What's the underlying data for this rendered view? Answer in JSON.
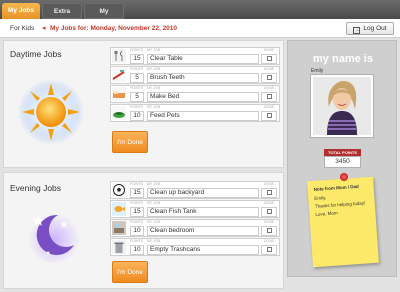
{
  "nav": {
    "tabs": [
      {
        "label": "My Jobs",
        "active": true
      },
      {
        "label": "Extra Jobs",
        "active": false
      },
      {
        "label": "My Store",
        "active": false
      }
    ]
  },
  "subbar": {
    "section": "For Kids",
    "heading": "My Jobs for: Monday, November 22, 2010",
    "logout": "Log Out"
  },
  "columns": {
    "points": "POINTS",
    "job": "MY JOB",
    "done": "DONE"
  },
  "daytime": {
    "title": "Daytime Jobs",
    "done_button": "I'm Done",
    "jobs": [
      {
        "points": "15",
        "name": "Clear Table",
        "icon": "utensils-icon"
      },
      {
        "points": "5",
        "name": "Brush Teeth",
        "icon": "toothbrush-icon"
      },
      {
        "points": "5",
        "name": "Make Bed",
        "icon": "bed-icon"
      },
      {
        "points": "10",
        "name": "Feed Pets",
        "icon": "pet-bowl-icon"
      }
    ]
  },
  "evening": {
    "title": "Evening Jobs",
    "done_button": "I'm Done",
    "jobs": [
      {
        "points": "15",
        "name": "Clean up backyard",
        "icon": "soccer-ball-icon"
      },
      {
        "points": "15",
        "name": "Clean Fish Tank",
        "icon": "fish-icon"
      },
      {
        "points": "10",
        "name": "Clean bedroom",
        "icon": "bedroom-icon"
      },
      {
        "points": "10",
        "name": "Empty Trashcans",
        "icon": "trashcan-icon"
      }
    ]
  },
  "profile": {
    "heading": "my name is",
    "name": "Emily",
    "total_points_label": "TOTAL POINTS",
    "total_points": "3450",
    "note": {
      "title": "Note from Mom / Dad",
      "greeting": "Emily,",
      "body": "Thanks for helping today!",
      "signoff": "Love, Mom"
    }
  },
  "colors": {
    "accent": "#f08a1e",
    "heading_red": "#c0392b",
    "note_yellow": "#fde96a"
  }
}
